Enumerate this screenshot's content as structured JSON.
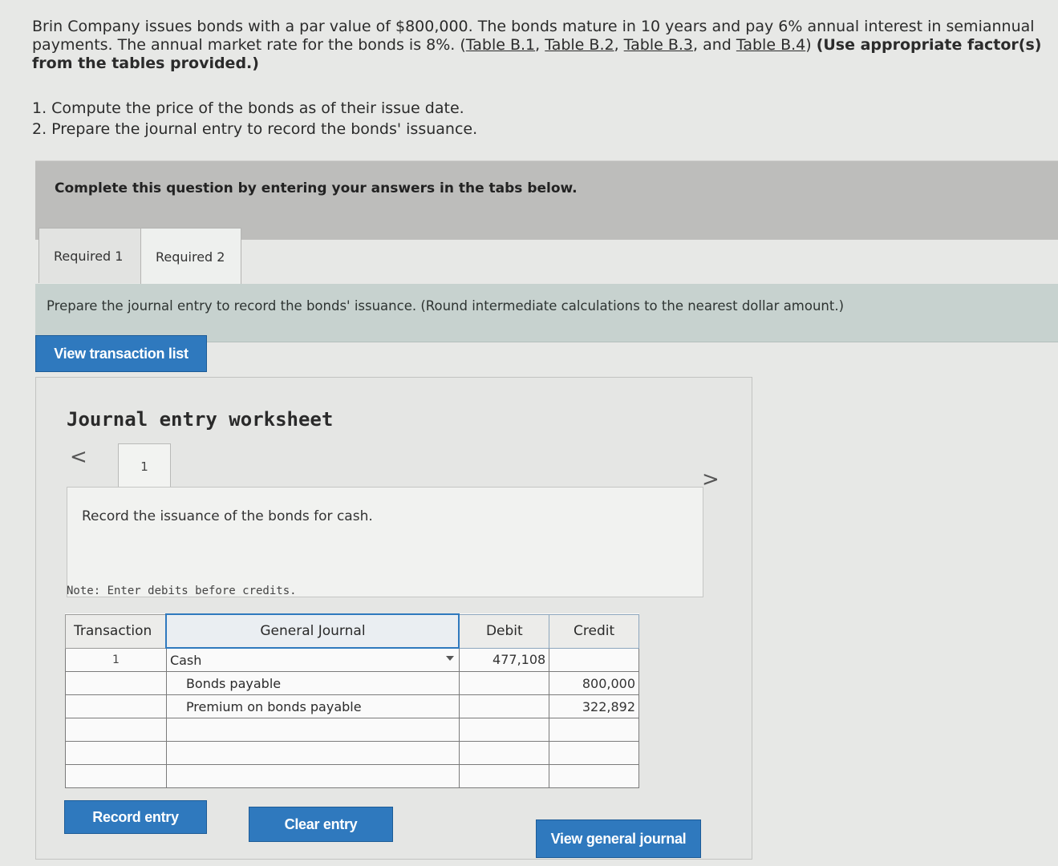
{
  "problem": {
    "text_a": "Brin Company issues bonds with a par value of $800,000. The bonds mature in 10 years and pay 6% annual interest in semiannual payments. The annual market rate for the bonds is 8%. (",
    "table_links": [
      "Table B.1",
      "Table B.2",
      "Table B.3",
      "Table B.4"
    ],
    "sep1": ", ",
    "sep2": ", ",
    "sep3": ", and ",
    "text_b": ") ",
    "bold_note": "(Use appropriate factor(s) from the tables provided.)"
  },
  "requirements": [
    "1. Compute the price of the bonds as of their issue date.",
    "2. Prepare the journal entry to record the bonds' issuance."
  ],
  "banner": "Complete this question by entering your answers in the tabs below.",
  "tabs": [
    "Required 1",
    "Required 2"
  ],
  "instruction": "Prepare the journal entry to record the bonds' issuance. (Round intermediate calculations to the nearest dollar amount.)",
  "buttons": {
    "view_transaction_list": "View transaction list",
    "record_entry": "Record entry",
    "clear_entry": "Clear entry",
    "view_general_journal": "View general journal"
  },
  "worksheet": {
    "title": "Journal entry worksheet",
    "page": "1",
    "nav_prev": "<",
    "nav_next": ">",
    "description": "Record the issuance of the bonds for cash.",
    "note": "Note: Enter debits before credits."
  },
  "journal": {
    "headers": {
      "transaction": "Transaction",
      "general_journal": "General Journal",
      "debit": "Debit",
      "credit": "Credit"
    },
    "rows": [
      {
        "transaction": "1",
        "account": "Cash",
        "debit": "477,108",
        "credit": ""
      },
      {
        "transaction": "",
        "account": "Bonds payable",
        "debit": "",
        "credit": "800,000"
      },
      {
        "transaction": "",
        "account": "Premium on bonds payable",
        "debit": "",
        "credit": "322,892"
      },
      {
        "transaction": "",
        "account": "",
        "debit": "",
        "credit": ""
      },
      {
        "transaction": "",
        "account": "",
        "debit": "",
        "credit": ""
      },
      {
        "transaction": "",
        "account": "",
        "debit": "",
        "credit": ""
      }
    ]
  },
  "colors": {
    "accent": "#2f79be",
    "banner": "#bdbdbb",
    "instruction_bar": "#c7d2cf"
  }
}
